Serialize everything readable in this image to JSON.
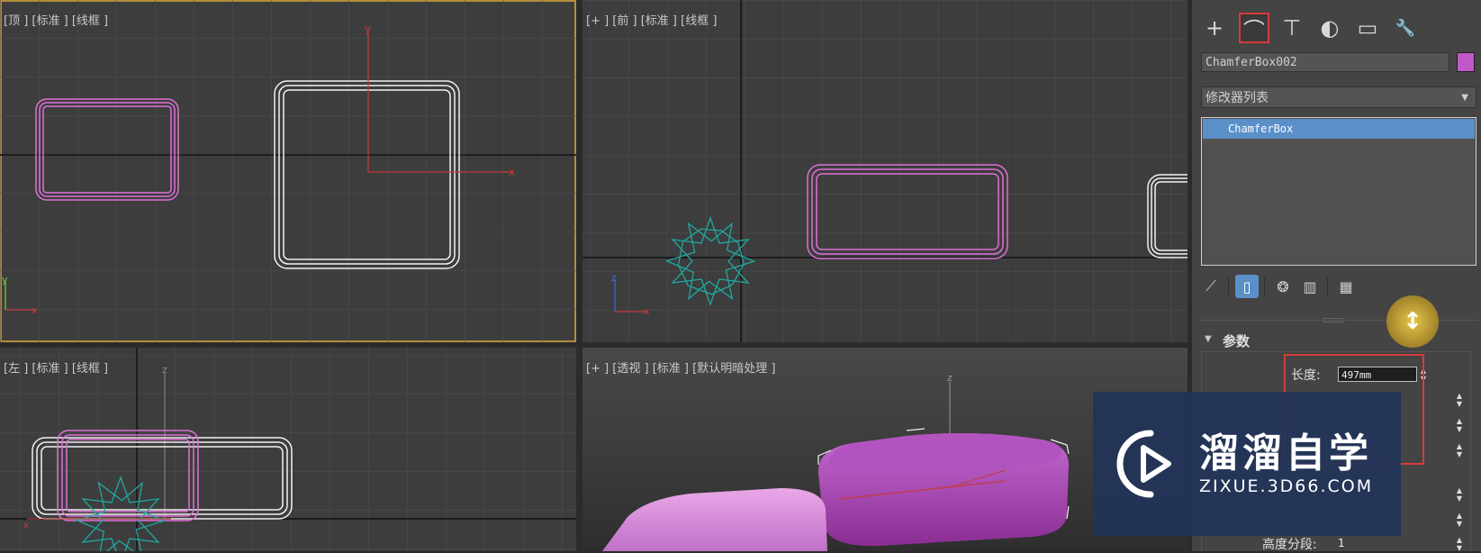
{
  "viewports": {
    "top": {
      "label": "[顶 ] [标准 ] [线框 ]"
    },
    "front": {
      "label": "[+ ] [前 ] [标准 ] [线框 ]"
    },
    "left": {
      "label": "[左 ] [标准 ] [线框 ]"
    },
    "perspective": {
      "label": "[+ ] [透视 ] [标准 ] [默认明暗处理 ]"
    }
  },
  "axes": {
    "x": "x",
    "y": "y",
    "z": "z"
  },
  "command_panel": {
    "tabs": [
      {
        "name": "create",
        "icon": "plus-icon",
        "glyph": "+"
      },
      {
        "name": "modify",
        "icon": "modify-curve-icon",
        "glyph": "⌒"
      },
      {
        "name": "hierarchy",
        "icon": "hierarchy-icon",
        "glyph": "⊤"
      },
      {
        "name": "motion",
        "icon": "motion-icon",
        "glyph": "◐"
      },
      {
        "name": "display",
        "icon": "monitor-icon",
        "glyph": "▭"
      },
      {
        "name": "utilities",
        "icon": "wrench-icon",
        "glyph": "🔧"
      }
    ],
    "object_name": "ChamferBox002",
    "object_color": "#c058c8",
    "modifier_list_label": "修改器列表",
    "modifier_stack": [
      "ChamferBox"
    ],
    "stack_tools": [
      {
        "icon": "pin-icon",
        "glyph": "📌"
      },
      {
        "icon": "show-end-result-icon",
        "glyph": "▯"
      },
      {
        "icon": "make-unique-icon",
        "glyph": "❂"
      },
      {
        "icon": "remove-modifier-icon",
        "glyph": "🗑"
      },
      {
        "icon": "configure-modifier-sets-icon",
        "glyph": "▦"
      }
    ],
    "rollout_title": "参数",
    "params": {
      "length_label": "长度:",
      "length_value": "497mm",
      "height_segments_label": "高度分段:",
      "height_segments_value": "1"
    }
  },
  "watermark": {
    "chinese": "溜溜自学",
    "english": "ZIXUE.3D66.COM"
  },
  "colors": {
    "accent_red": "#d93a3a",
    "selection_blue": "#5b8fc8",
    "pink_object": "#e070d8",
    "helper_teal": "#1fa8a0",
    "active_viewport_border": "#b48e3a"
  }
}
